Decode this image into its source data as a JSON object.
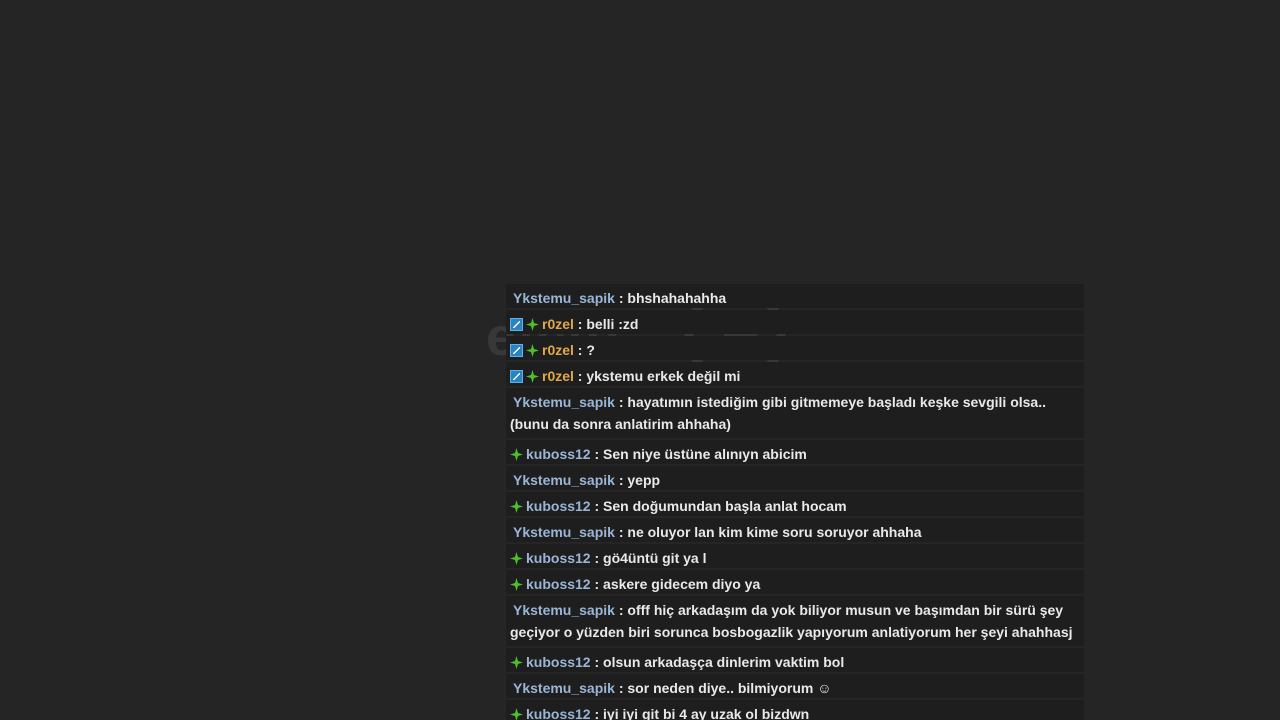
{
  "chat": {
    "messages": [
      {
        "user": "Ykstemu_sapik",
        "user_type": "ykst",
        "badges": [],
        "text": " : bhshahahahha"
      },
      {
        "user": "r0zel",
        "user_type": "rozel",
        "badges": [
          "arrow-square-icon",
          "green-star-icon"
        ],
        "text": " : belli :zd"
      },
      {
        "user": "r0zel",
        "user_type": "rozel",
        "badges": [
          "arrow-square-icon",
          "green-star-icon"
        ],
        "text": " : ?"
      },
      {
        "user": "r0zel",
        "user_type": "rozel",
        "badges": [
          "arrow-square-icon",
          "green-star-icon"
        ],
        "text": " : ykstemu erkek değil mi"
      },
      {
        "user": "Ykstemu_sapik",
        "user_type": "ykst",
        "badges": [],
        "text": " : hayatımın istediğim gibi gitmemeye başladı keşke sevgili olsa.. (bunu da sonra anlatirim ahhaha)",
        "lines": 2
      },
      {
        "user": "kuboss12",
        "user_type": "kuboss",
        "badges": [
          "green-star-icon"
        ],
        "text": " : Sen niye üstüne alınıyn abicim"
      },
      {
        "user": "Ykstemu_sapik",
        "user_type": "ykst",
        "badges": [],
        "text": " : yepp"
      },
      {
        "user": "kuboss12",
        "user_type": "kuboss",
        "badges": [
          "green-star-icon"
        ],
        "text": " : Sen doğumundan başla anlat hocam"
      },
      {
        "user": "Ykstemu_sapik",
        "user_type": "ykst",
        "badges": [],
        "text": " : ne oluyor lan kim kime soru soruyor ahhaha"
      },
      {
        "user": "kuboss12",
        "user_type": "kuboss",
        "badges": [
          "green-star-icon"
        ],
        "text": " : gö4üntü git ya l"
      },
      {
        "user": "kuboss12",
        "user_type": "kuboss",
        "badges": [
          "green-star-icon"
        ],
        "text": " : askere gidecem diyo ya"
      },
      {
        "user": "Ykstemu_sapik",
        "user_type": "ykst",
        "badges": [],
        "text": " : offf hiç arkadaşım da yok biliyor musun ve başımdan bir sürü şey geçiyor o yüzden biri sorunca bosbogazlik yapıyorum anlatiyorum her şeyi ahahhasj",
        "lines": 2
      },
      {
        "user": "kuboss12",
        "user_type": "kuboss",
        "badges": [
          "green-star-icon"
        ],
        "text": " : olsun arkadaşça dinlerim vaktim bol"
      },
      {
        "user": "Ykstemu_sapik",
        "user_type": "ykst",
        "badges": [],
        "text": " : sor neden diye.. bilmiyorum ☺"
      },
      {
        "user": "kuboss12",
        "user_type": "kuboss",
        "badges": [
          "green-star-icon"
        ],
        "text": " : iyi iyi git bi 4 ay uzak ol bizdwn"
      }
    ]
  },
  "watermark": {
    "logo_text": "efeto",
    "sub_text": "Tibo Signal"
  },
  "colors": {
    "background": "#252525",
    "row_background": "#1e1e1e",
    "name_blue": "#9ab5d6",
    "name_orange": "#e0a84a",
    "star_green": "#4fbf2a",
    "badge_blue": "#2a84c4"
  }
}
